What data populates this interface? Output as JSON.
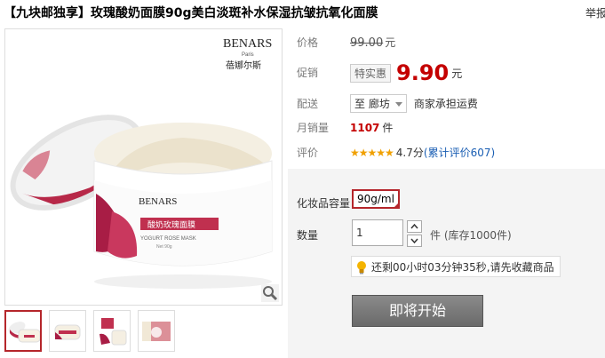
{
  "title": "【九块邮独享】玫瑰酸奶面膜90g美白淡斑补水保湿抗皱抗氧化面膜",
  "report_link": "举报",
  "product": {
    "brand_logo": "BENARS",
    "brand_logo_small": "Paris",
    "brand_cn": "蓓娜尔斯",
    "jar_label_cn": "酸奶玫瑰面膜",
    "jar_label_en": "YOGURT ROSE MASK",
    "jar_weight": "Net 90g"
  },
  "price": {
    "label": "价格",
    "original": "99.00",
    "unit": "元"
  },
  "promo": {
    "label": "促销",
    "tag": "特实惠",
    "price": "9.90",
    "unit": "元"
  },
  "delivery": {
    "label": "配送",
    "to": "至 廊坊",
    "shipping": "商家承担运费"
  },
  "monthly_sales": {
    "label": "月销量",
    "count": "1107",
    "unit": "件"
  },
  "rating": {
    "label": "评价",
    "stars": "★★★★★",
    "score": "4.7分",
    "reviews": "(累计评价607)"
  },
  "options": {
    "spec_label": "化妆品容量",
    "spec_value": "90g/ml",
    "qty_label": "数量",
    "qty_value": "1",
    "stock_text": "件 (库存1000件)",
    "tip": "还剩00小时03分钟35秒,请先收藏商品",
    "start_button": "即将开始"
  },
  "icons": {
    "zoom": "magnifier-icon",
    "tip": "lightbulb-icon"
  },
  "colors": {
    "accent": "#c40000",
    "selected_border": "#b5262b",
    "link": "#1a5eb3"
  }
}
